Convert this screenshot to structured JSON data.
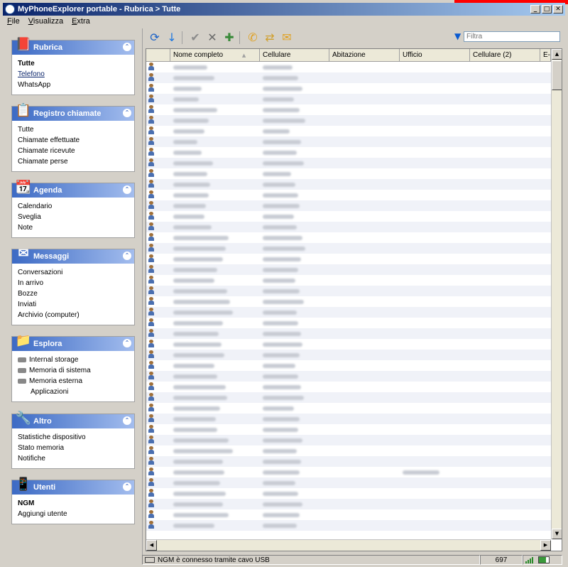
{
  "window": {
    "title": "MyPhoneExplorer portable - Rubrica > Tutte",
    "minimize": "_",
    "maximize": "□",
    "close": "✕"
  },
  "menu": [
    "File",
    "Visualizza",
    "Extra"
  ],
  "sidebar": {
    "collapse_glyph": "⌃",
    "sections": [
      {
        "title": "Rubrica",
        "icon": "address-book-icon",
        "items": [
          "Tutte",
          "Telefono",
          "WhatsApp"
        ]
      },
      {
        "title": "Registro chiamate",
        "icon": "call-log-icon",
        "items": [
          "Tutte",
          "Chiamate effettuate",
          "Chiamate ricevute",
          "Chiamate perse"
        ]
      },
      {
        "title": "Agenda",
        "icon": "calendar-icon",
        "items": [
          "Calendario",
          "Sveglia",
          "Note"
        ]
      },
      {
        "title": "Messaggi",
        "icon": "envelope-icon",
        "items": [
          "Conversazioni",
          "In arrivo",
          "Bozze",
          "Inviati",
          "Archivio (computer)"
        ]
      },
      {
        "title": "Esplora",
        "icon": "folder-icon",
        "items": [
          "Internal storage",
          "Memoria di sistema",
          "Memoria esterna",
          "Applicazioni"
        ]
      },
      {
        "title": "Altro",
        "icon": "tools-icon",
        "items": [
          "Statistiche dispositivo",
          "Stato memoria",
          "Notifiche"
        ]
      },
      {
        "title": "Utenti",
        "icon": "phone-icon",
        "items": [
          "NGM",
          "Aggiungi utente"
        ]
      }
    ]
  },
  "toolbar": {
    "refresh": "⟳",
    "download": "↓",
    "check": "✔",
    "delete": "✕",
    "add_contact": "✚",
    "call": "✆",
    "sync": "⇄",
    "message": "✉"
  },
  "filter": {
    "placeholder": "Filtra",
    "icon": "▼"
  },
  "grid": {
    "columns": [
      "",
      "Nome completo",
      "Cellulare",
      "Abitazione",
      "Ufficio",
      "Cellulare (2)",
      "E-m"
    ],
    "sort_indicator": "▲",
    "row_count": 44
  },
  "scroll": {
    "up": "▲",
    "down": "▼",
    "left": "◀",
    "right": "▶"
  },
  "status": {
    "message": "NGM è connesso tramite cavo USB",
    "count": "697"
  }
}
